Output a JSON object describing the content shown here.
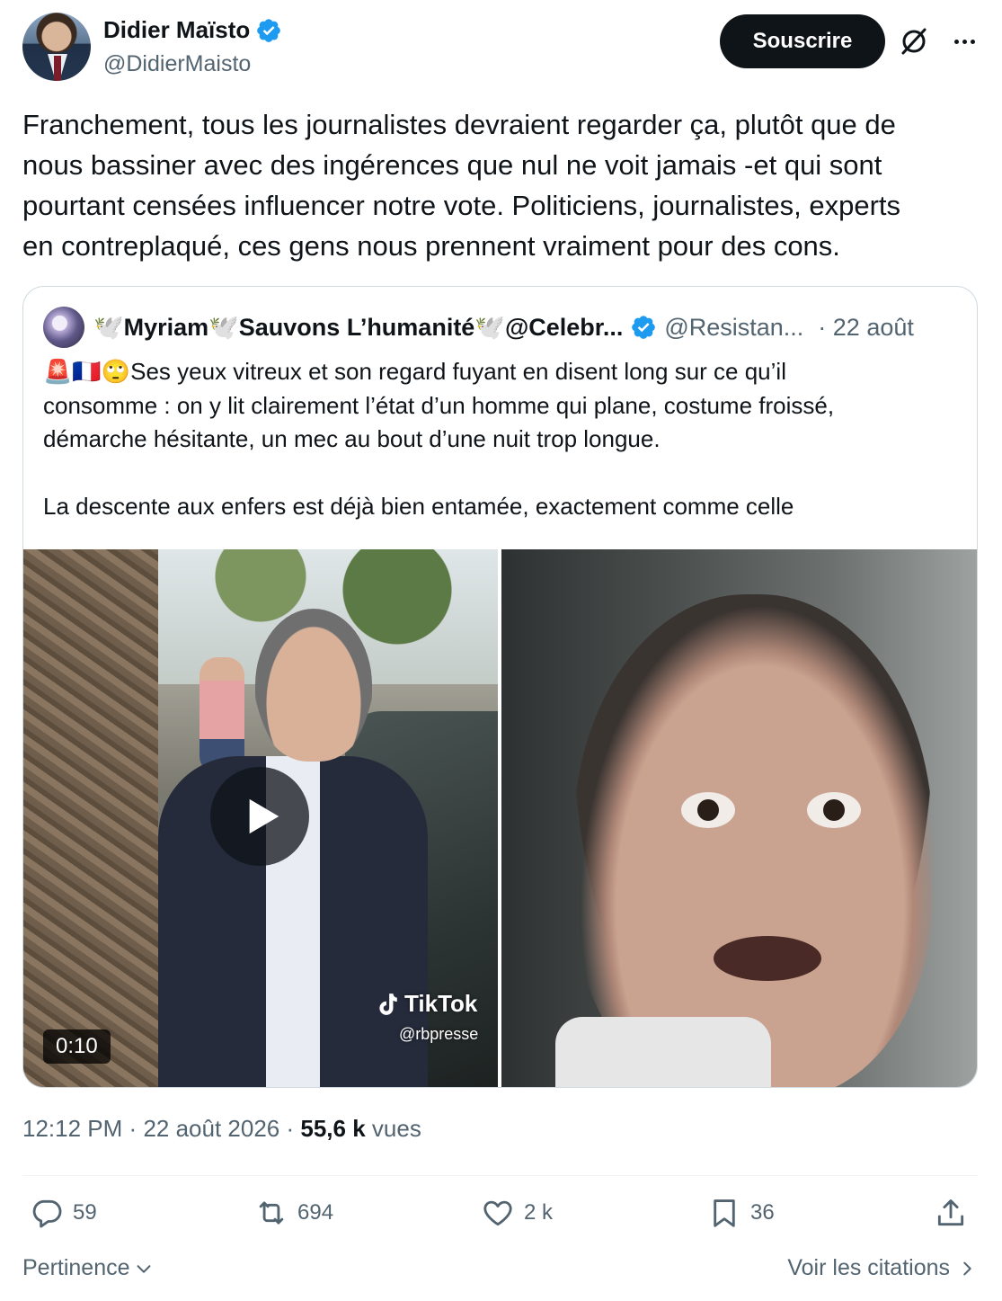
{
  "author": {
    "name": "Didier Maïsto",
    "handle": "@DidierMaisto",
    "verified": true
  },
  "header": {
    "subscribe_label": "Souscrire"
  },
  "tweet": {
    "text": "Franchement, tous les journalistes devraient regarder ça, plutôt que de\nnous bassiner avec des ingérences que nul ne voit jamais -et qui sont\npourtant censées influencer notre vote. Politiciens, journalistes, experts\nen contreplaqué, ces gens nous prennent vraiment pour des cons."
  },
  "quote": {
    "name": "🕊️Myriam🕊️Sauvons L’humanité🕊️@Celebr...",
    "handle": "@Resistan...",
    "date": "· 22 août",
    "text": "🚨🇫🇷🙄Ses yeux vitreux et son regard fuyant en disent long sur ce qu’il\nconsomme : on y lit clairement l’état d’un homme qui plane, costume froissé,\ndémarche hésitante, un mec au bout d’une nuit trop longue.\n\nLa descente aux enfers est déjà bien entamée, exactement comme celle",
    "video": {
      "duration": "0:10",
      "watermark_brand": "TikTok",
      "watermark_handle": "@rbpresse"
    }
  },
  "meta": {
    "time": "12:12 PM",
    "sep1": "·",
    "date": "22 août 2026",
    "sep2": "·",
    "views_count": "55,6 k",
    "views_label": "vues"
  },
  "actions": {
    "replies": "59",
    "reposts": "694",
    "likes": "2 k",
    "bookmarks": "36"
  },
  "footer": {
    "sort_label": "Pertinence",
    "quotes_link": "Voir les citations"
  },
  "colors": {
    "text_primary": "#0f1419",
    "text_secondary": "#536471",
    "verified_blue": "#1d9bf0",
    "border": "#cfd9de"
  }
}
